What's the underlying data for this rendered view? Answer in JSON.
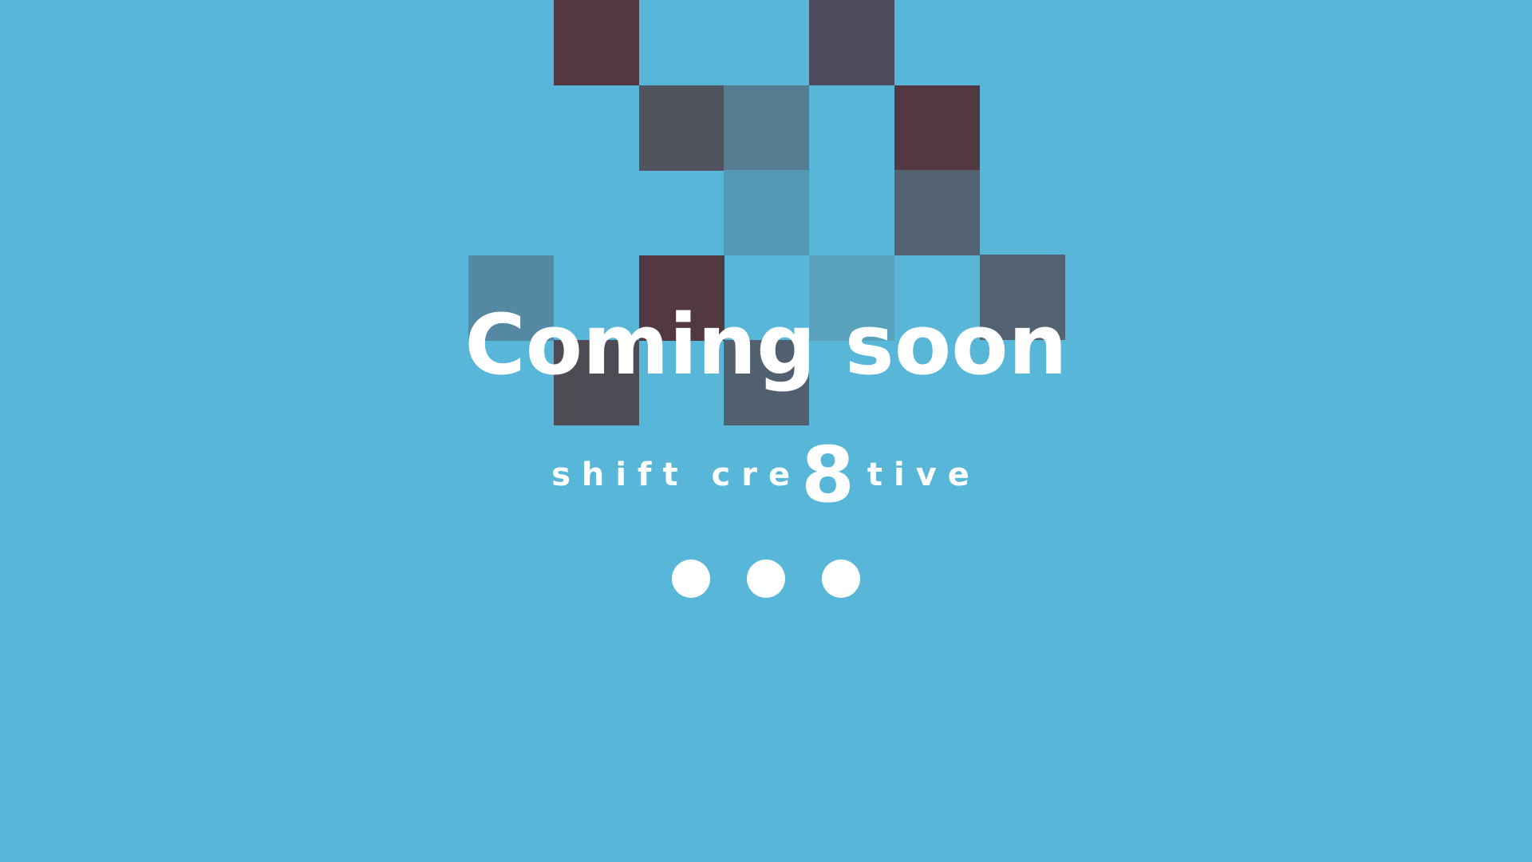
{
  "page": {
    "background_color": "#58b7d8",
    "headline": "Coming soon",
    "brand": {
      "prefix": "shift cre",
      "numeral": "8",
      "suffix": "tive"
    },
    "loading_dots": 3
  },
  "mosaic": {
    "tile_colors": [
      "#523840",
      "#4f4b5c",
      "#51535f",
      "#557c90",
      "#5499b3",
      "#536270",
      "#5589a3",
      "#58a2bd"
    ]
  }
}
